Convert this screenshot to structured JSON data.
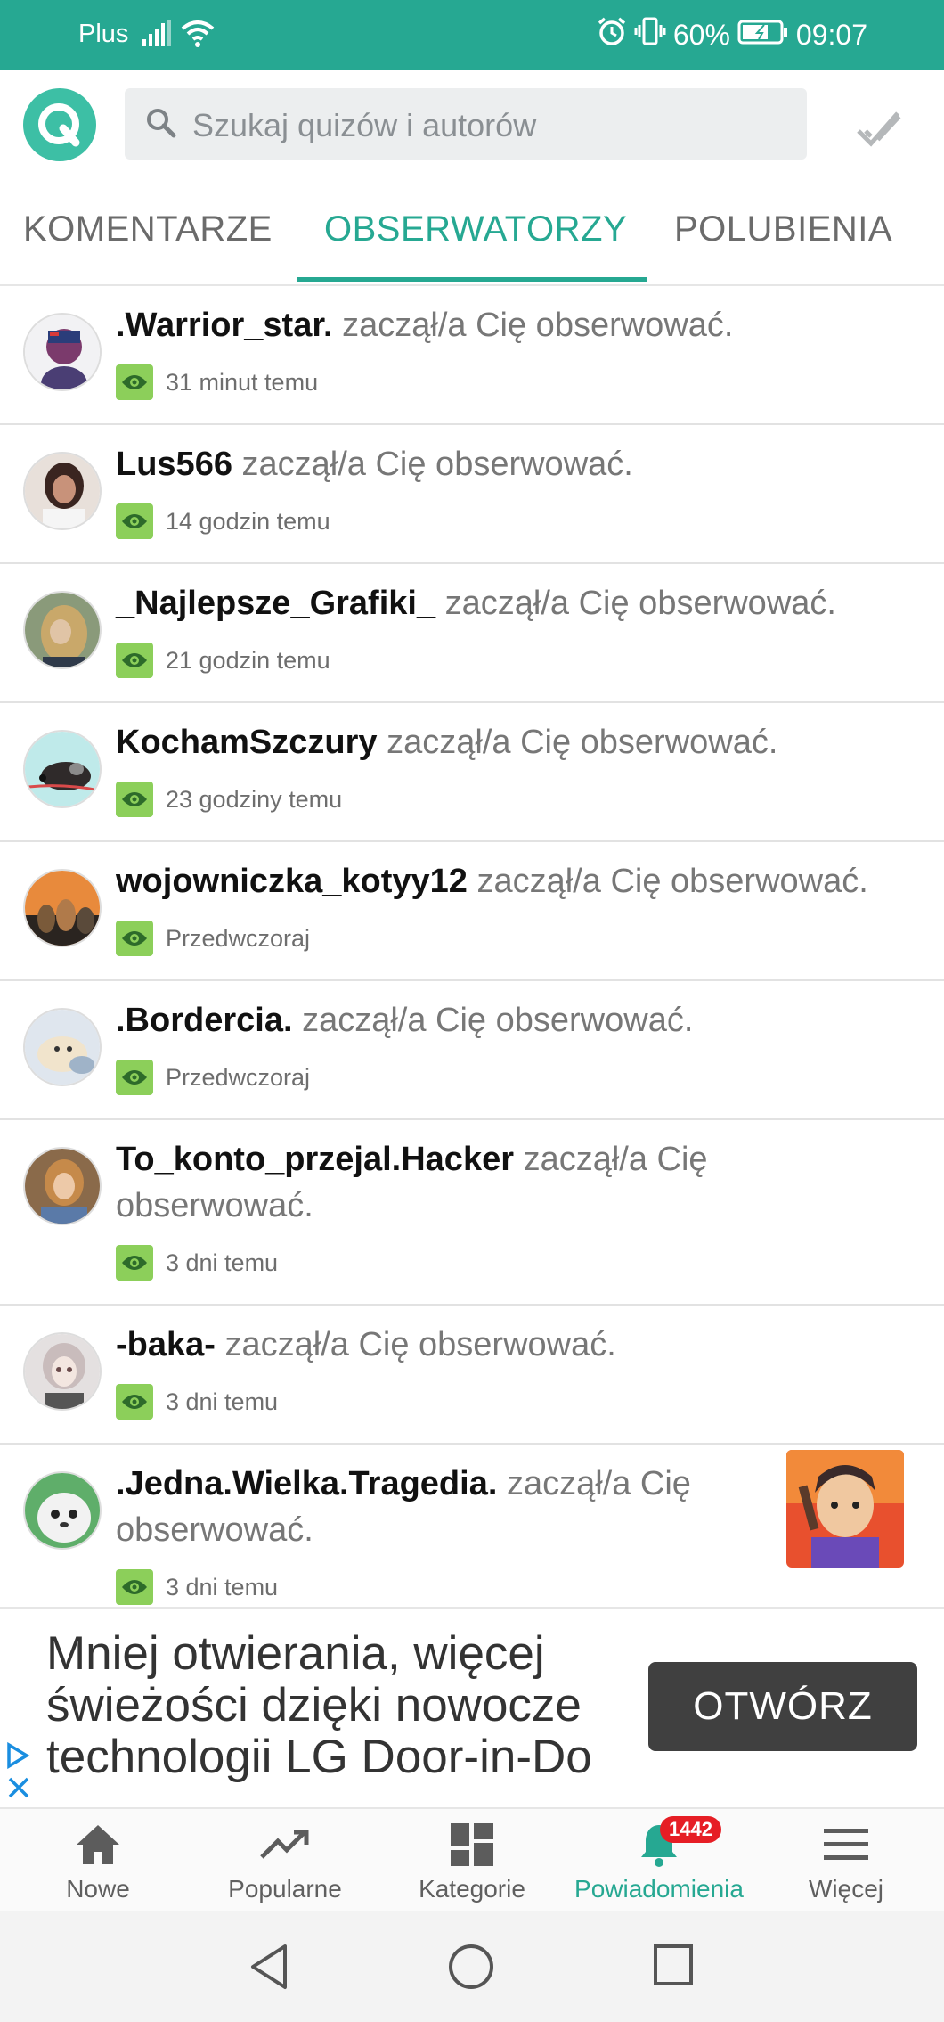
{
  "status_bar": {
    "carrier": "Plus",
    "battery": "60%",
    "time": "09:07"
  },
  "search": {
    "placeholder": "Szukaj quizów i autorów"
  },
  "tabs": [
    {
      "label": "KOMENTARZE",
      "active": false
    },
    {
      "label": "OBSERWATORZY",
      "active": true
    },
    {
      "label": "POLUBIENIA",
      "active": false
    }
  ],
  "notifications": [
    {
      "user": ".Warrior_star.",
      "text": " zaczął/a Cię obserwować.",
      "time": "31 minut temu"
    },
    {
      "user": "Lus566",
      "text": " zaczął/a Cię obserwować.",
      "time": "14 godzin temu"
    },
    {
      "user": "_Najlepsze_Grafiki_",
      "text": " zaczął/a Cię obserwować.",
      "time": "21 godzin temu"
    },
    {
      "user": "KochamSzczury",
      "text": " zaczął/a Cię obserwować.",
      "time": "23 godziny temu"
    },
    {
      "user": "wojowniczka_kotyy12",
      "text": " zaczął/a Cię obserwować.",
      "time": "Przedwczoraj"
    },
    {
      "user": ".Bordercia.",
      "text": " zaczął/a Cię obserwować.",
      "time": "Przedwczoraj"
    },
    {
      "user": "To_konto_przejal.Hacker",
      "text": " zaczął/a Cię obserwować.",
      "time": "3 dni temu"
    },
    {
      "user": "-baka-",
      "text": " zaczął/a Cię obserwować.",
      "time": "3 dni temu"
    },
    {
      "user": ".Jedna.Wielka.Tragedia.",
      "text": " zaczął/a Cię obserwować.",
      "time": "3 dni temu"
    }
  ],
  "ad": {
    "text_lines": [
      "Mniej otwierania, więcej",
      "świeżości dzięki nowocze",
      "technologii LG Door-in-Do"
    ],
    "button": "OTWÓRZ"
  },
  "bottom_nav": [
    {
      "label": "Nowe",
      "icon": "home-icon"
    },
    {
      "label": "Popularne",
      "icon": "trending-icon"
    },
    {
      "label": "Kategorie",
      "icon": "categories-icon"
    },
    {
      "label": "Powiadomienia",
      "icon": "bell-icon",
      "badge": "1442",
      "active": true
    },
    {
      "label": "Więcej",
      "icon": "menu-icon"
    }
  ],
  "colors": {
    "accent": "#26a892",
    "eye_badge": "#8ccf5a",
    "badge_red": "#e61e25"
  }
}
